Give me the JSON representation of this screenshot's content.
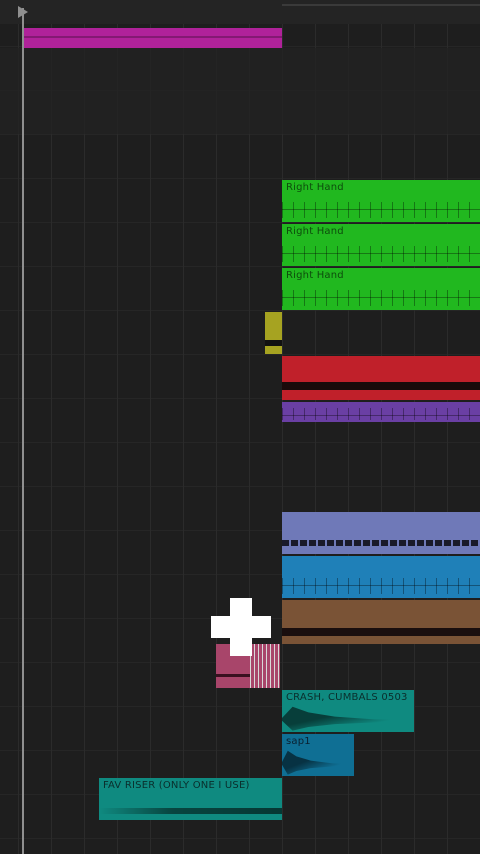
{
  "clips": {
    "right_hand_1": {
      "label": "Right Hand",
      "color": "#21b81f"
    },
    "right_hand_2": {
      "label": "Right Hand",
      "color": "#21b81f"
    },
    "right_hand_3": {
      "label": "Right Hand",
      "color": "#21b81f"
    },
    "crash_cymbals": {
      "label": "CRASH, CUMBALS 0503",
      "color": "#0f8a80"
    },
    "clap": {
      "label": "sap1",
      "color": "#0f6f94"
    },
    "fav_riser": {
      "label": "FAV RISER (ONLY ONE I USE)",
      "color": "#0f8a80"
    }
  },
  "colors": {
    "magenta": "#b0229a",
    "olive": "#a6a321",
    "red": "#c0202a",
    "purple": "#6a3fa4",
    "lavender": "#6f79b8",
    "blue": "#1f80b8",
    "brown": "#7a5336",
    "pink": "#a8456a",
    "background": "#1e1e1e"
  },
  "cursor": "crosshair-icon"
}
